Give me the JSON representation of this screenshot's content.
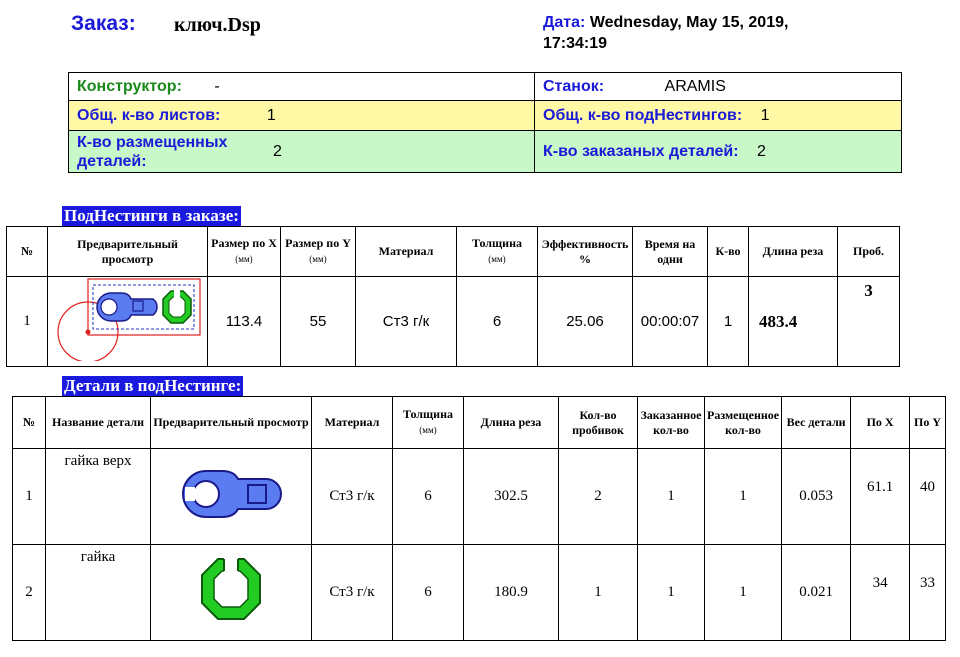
{
  "header": {
    "order_label": "Заказ:",
    "order_value": "ключ.Dsp",
    "date_label": "Дата:",
    "date_value_line1": "Wednesday, May 15, 2019,",
    "date_value_line2": "17:34:19"
  },
  "info": {
    "designer_label": "Конструктор:",
    "designer_value": "-",
    "machine_label": "Станок:",
    "machine_value": "ARAMIS",
    "sheets_label": "Общ. к-во листов:",
    "sheets_value": "1",
    "subnest_label": "Общ. к-во подНестингов:",
    "subnest_value": "1",
    "placed_label_line1": "К-во размещенных",
    "placed_label_line2": "деталей:",
    "placed_value": "2",
    "ordered_label": "К-во заказаных деталей:",
    "ordered_value": "2"
  },
  "subnests": {
    "title": "ПодНестинги в заказе:",
    "headers": {
      "num": "№",
      "preview": "Предварительный просмотр",
      "sizex_top": "Размер по X",
      "sizex_unit": "(мм)",
      "sizey_top": "Размер по Y",
      "sizey_unit": "(мм)",
      "material": "Материал",
      "thickness": "Толщина",
      "thickness_unit": "(мм)",
      "efficiency": "Эффективность %",
      "time": "Время на одни",
      "qty": "К-во",
      "cut_length": "Длина реза",
      "pierce": "Проб."
    },
    "rows": [
      {
        "num": "1",
        "size_x": "113.4",
        "size_y": "55",
        "material": "Ст3 г/к",
        "thickness": "6",
        "efficiency": "25.06",
        "time": "00:00:07",
        "qty": "1",
        "cut_length": "483.4",
        "pierce": "3"
      }
    ]
  },
  "parts": {
    "title": "Детали в подНестинге:",
    "headers": {
      "num": "№",
      "name": "Название детали",
      "preview": "Предварительный просмотр",
      "material": "Материал",
      "thickness": "Толщина",
      "thickness_unit": "(мм)",
      "cut_length": "Длина реза",
      "pierces": "Кол-во пробивок",
      "ordered": "Заказанное кол-во",
      "placed": "Размещенное кол-во",
      "weight": "Вес детали",
      "pos_x": "По X",
      "pos_y": "По Y"
    },
    "rows": [
      {
        "num": "1",
        "name": "гайка верх",
        "material": "Ст3 г/к",
        "thickness": "6",
        "cut_length": "302.5",
        "pierces": "2",
        "ordered": "1",
        "placed": "1",
        "weight": "0.053",
        "pos_x": "61.1",
        "pos_y": "40"
      },
      {
        "num": "2",
        "name": "гайка",
        "material": "Ст3 г/к",
        "thickness": "6",
        "cut_length": "180.9",
        "pierces": "1",
        "ordered": "1",
        "placed": "1",
        "weight": "0.021",
        "pos_x": "34",
        "pos_y": "33"
      }
    ]
  },
  "colors": {
    "title_blue": "#1a1ad8",
    "label_green": "#1a8a1a",
    "row_yellow": "#fff9a6",
    "row_green": "#c8f7c8",
    "part_blue": "#5b7bf0",
    "part_green": "#22cc22"
  }
}
